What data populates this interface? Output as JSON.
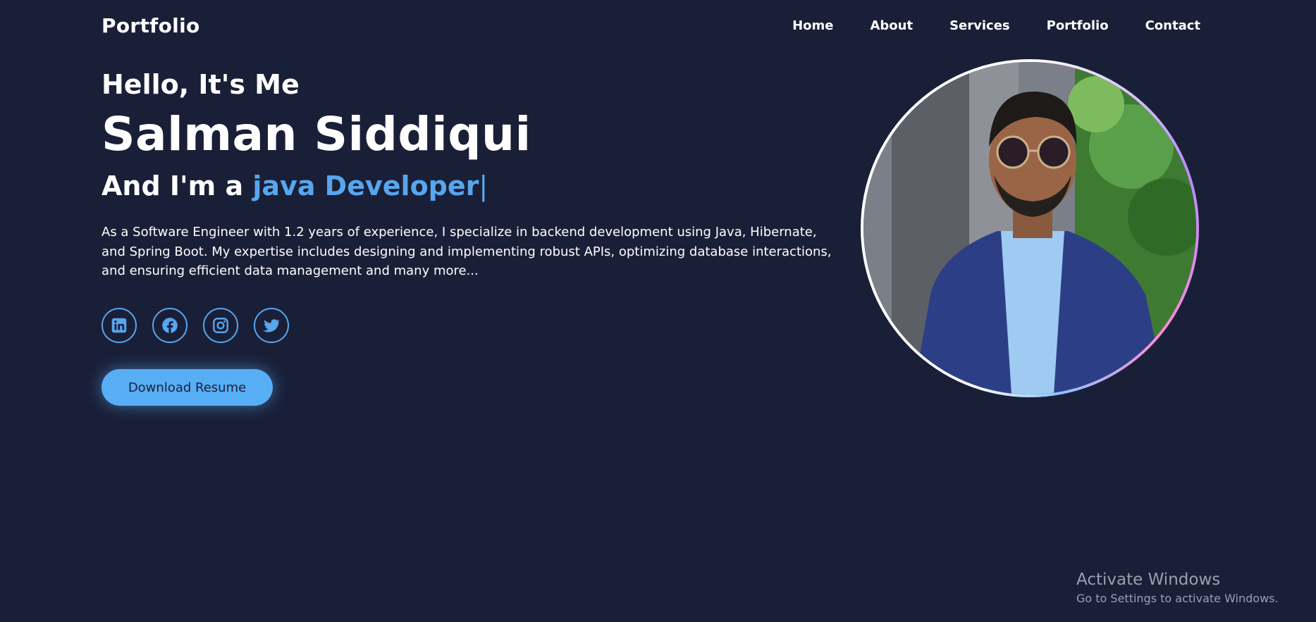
{
  "header": {
    "logo": "Portfolio",
    "nav": [
      {
        "label": "Home"
      },
      {
        "label": "About"
      },
      {
        "label": "Services"
      },
      {
        "label": "Portfolio"
      },
      {
        "label": "Contact"
      }
    ]
  },
  "hero": {
    "greeting": "Hello, It's Me",
    "name": "Salman Siddiqui",
    "role_prefix": "And I'm a ",
    "role_typed": "java Developer",
    "role_cursor": "|",
    "bio": "As a Software Engineer with 1.2 years of experience, I specialize in backend development using Java, Hibernate, and Spring Boot. My expertise includes designing and implementing robust APIs, optimizing database interactions, and ensuring efficient data management and many more...",
    "socials": [
      {
        "icon": "linkedin-icon"
      },
      {
        "icon": "facebook-icon"
      },
      {
        "icon": "instagram-icon"
      },
      {
        "icon": "twitter-icon"
      }
    ],
    "button_label": "Download Resume"
  },
  "watermark": {
    "title": "Activate Windows",
    "subtitle": "Go to Settings to activate Windows."
  },
  "colors": {
    "background": "#1a1f38",
    "accent": "#58a6ec",
    "button": "#58aef5"
  }
}
